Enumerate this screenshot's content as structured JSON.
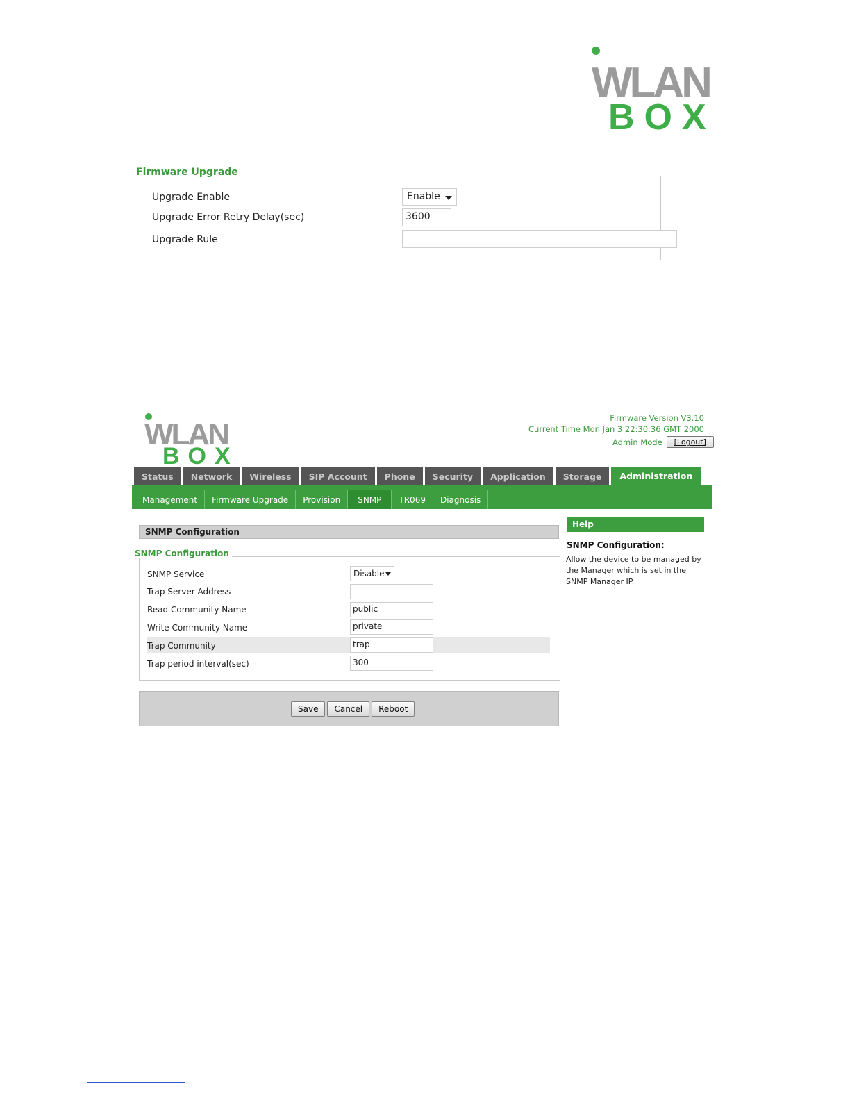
{
  "logo": {
    "word": "WLAN",
    "sub": "BOX"
  },
  "firmware_panel": {
    "legend": "Firmware Upgrade",
    "rows": [
      {
        "label": "Upgrade Enable",
        "value": "Enable",
        "type": "select"
      },
      {
        "label": "Upgrade Error Retry Delay(sec)",
        "value": "3600",
        "type": "input"
      },
      {
        "label": "Upgrade Rule",
        "value": "",
        "type": "input"
      }
    ]
  },
  "header": {
    "firmware_version": "Firmware Version V3.10",
    "current_time": "Current Time Mon Jan 3 22:30:36 GMT 2000",
    "mode": "Admin Mode",
    "logout_label": "[Logout]"
  },
  "tabs": [
    "Status",
    "Network",
    "Wireless",
    "SIP Account",
    "Phone",
    "Security",
    "Application",
    "Storage",
    "Administration"
  ],
  "active_tab": "Administration",
  "subtabs": [
    "Management",
    "Firmware Upgrade",
    "Provision",
    "SNMP",
    "TR069",
    "Diagnosis"
  ],
  "active_subtab": "SNMP",
  "section_title": "SNMP Configuration",
  "snmp": {
    "legend": "SNMP Configuration",
    "rows": [
      {
        "label": "SNMP Service",
        "value": "Disable",
        "type": "select"
      },
      {
        "label": "Trap Server Address",
        "value": "",
        "type": "input"
      },
      {
        "label": "Read Community Name",
        "value": "public",
        "type": "input"
      },
      {
        "label": "Write Community Name",
        "value": "private",
        "type": "input"
      },
      {
        "label": "Trap Community",
        "value": "trap",
        "type": "input"
      },
      {
        "label": "Trap period interval(sec)",
        "value": "300",
        "type": "input"
      }
    ]
  },
  "buttons": {
    "save": "Save",
    "cancel": "Cancel",
    "reboot": "Reboot"
  },
  "help": {
    "header": "Help",
    "title": "SNMP Configuration:",
    "text": "Allow the device to be managed by the Manager which is set in the SNMP Manager IP."
  },
  "colors": {
    "brand_green": "#3d9e3f",
    "logo_gray": "#9b9b9b",
    "tab_dark": "#555555"
  }
}
